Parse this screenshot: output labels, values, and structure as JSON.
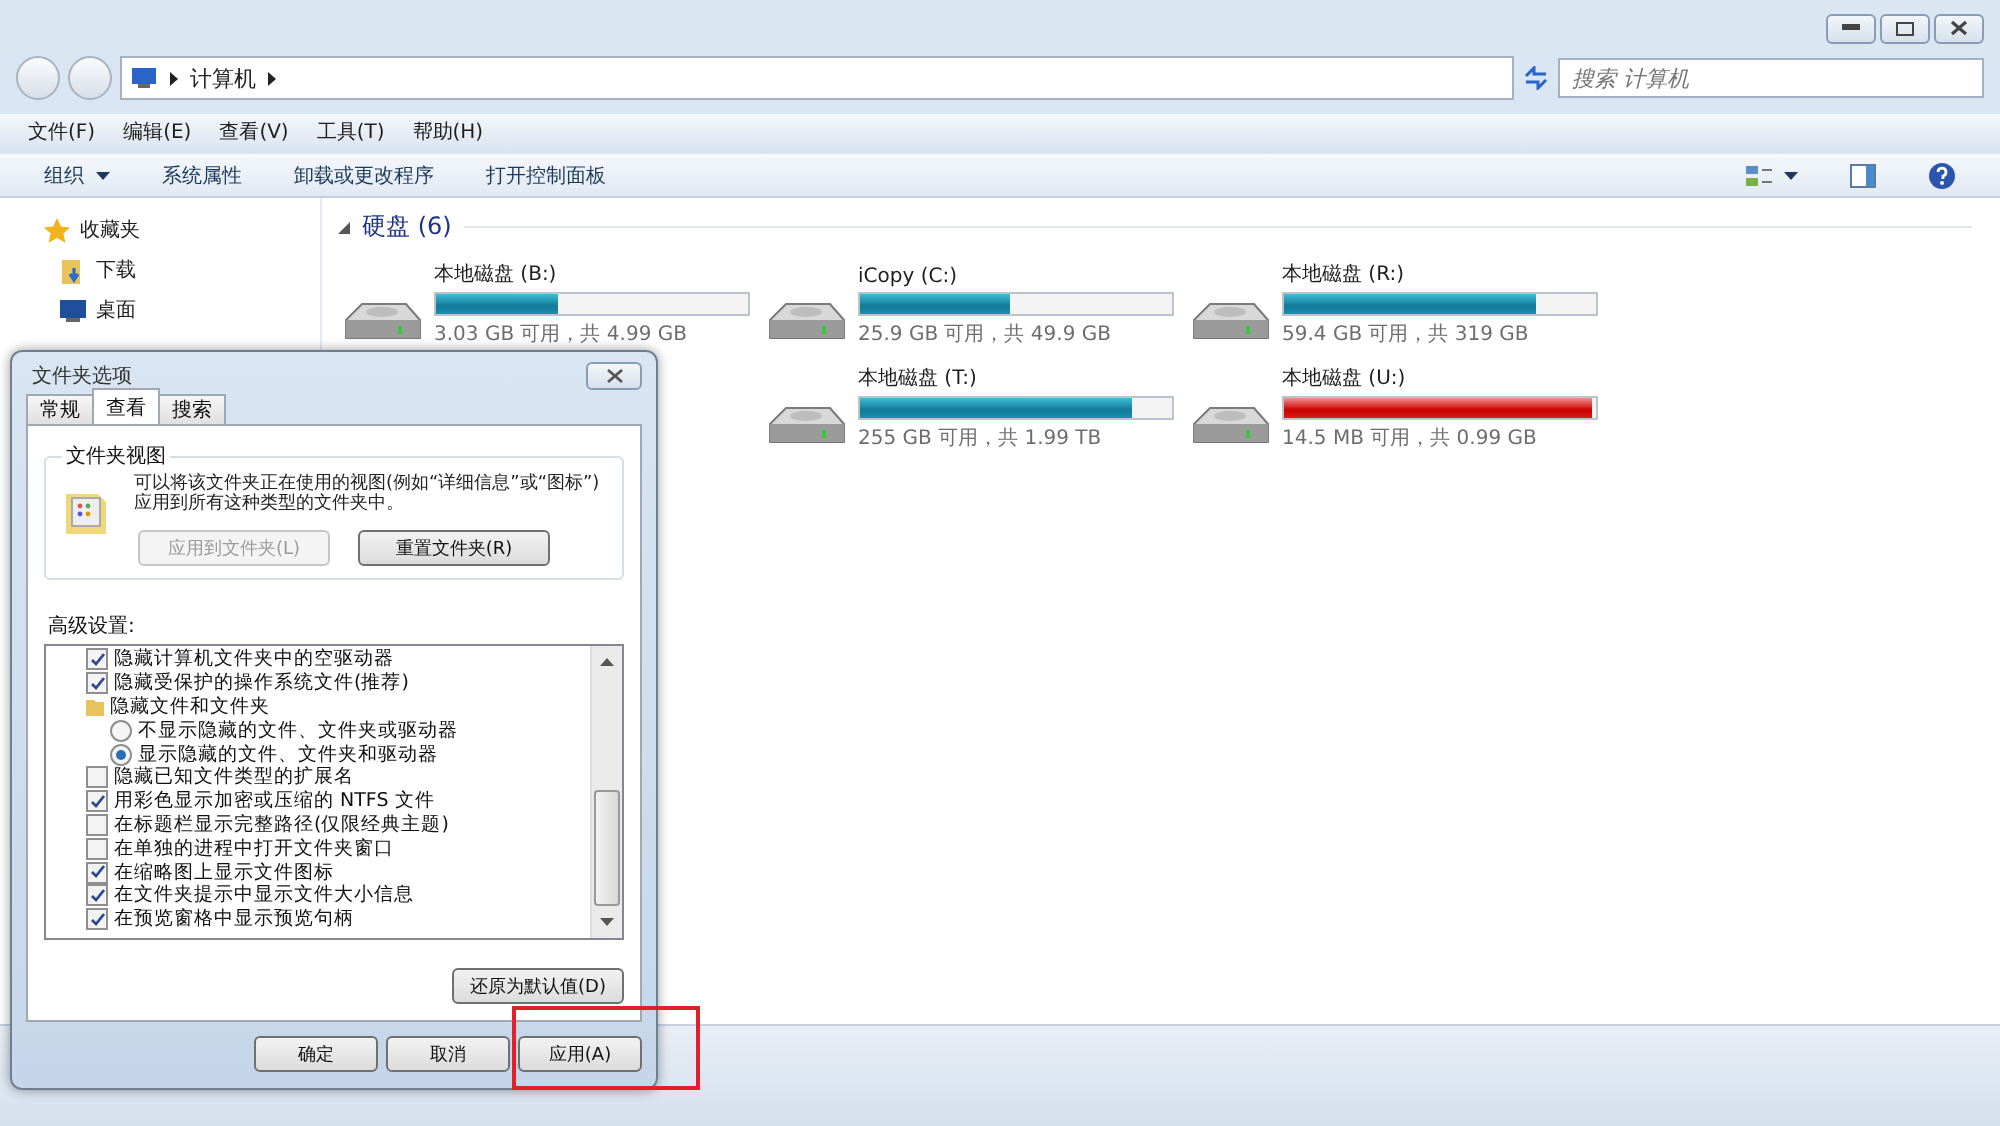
{
  "address": {
    "crumbs": [
      "计算机"
    ]
  },
  "search": {
    "placeholder": "搜索 计算机"
  },
  "menu": [
    "文件(F)",
    "编辑(E)",
    "查看(V)",
    "工具(T)",
    "帮助(H)"
  ],
  "commands": [
    {
      "label": "组织",
      "dropdown": true
    },
    {
      "label": "系统属性",
      "dropdown": false
    },
    {
      "label": "卸载或更改程序",
      "dropdown": false
    },
    {
      "label": "打开控制面板",
      "dropdown": false
    }
  ],
  "sidebar": {
    "items": [
      {
        "label": "收藏夹",
        "kind": "star"
      },
      {
        "label": "下载",
        "kind": "download"
      },
      {
        "label": "桌面",
        "kind": "desktop"
      }
    ]
  },
  "group": {
    "title": "硬盘 (6)"
  },
  "drives": [
    {
      "name": "本地磁盘 (B:)",
      "level": 0.39,
      "full": false,
      "info": "3.03 GB 可用，共 4.99 GB"
    },
    {
      "name": "iCopy (C:)",
      "level": 0.48,
      "full": false,
      "info": "25.9 GB 可用，共 49.9 GB"
    },
    {
      "name": "本地磁盘 (R:)",
      "level": 0.81,
      "full": false,
      "info": "59.4 GB 可用，共 319 GB"
    },
    {
      "name": "本地磁盘 (T:)",
      "level": 0.87,
      "full": false,
      "info": "255 GB 可用，共 1.99 TB"
    },
    {
      "name": "本地磁盘 (U:)",
      "level": 0.99,
      "full": true,
      "info": "14.5 MB 可用，共 0.99 GB"
    }
  ],
  "dialog": {
    "title": "文件夹选项",
    "tabs": [
      {
        "label": "常规",
        "selected": false
      },
      {
        "label": "查看",
        "selected": true
      },
      {
        "label": "搜索",
        "selected": false
      }
    ],
    "folder_views": {
      "title": "文件夹视图",
      "text": "可以将该文件夹正在使用的视图(例如“详细信息”或“图标”)应用到所有这种类型的文件夹中。",
      "buttons": [
        {
          "label": "应用到文件夹(L)",
          "disabled": true
        },
        {
          "label": "重置文件夹(R)",
          "disabled": false
        }
      ]
    },
    "advanced_label": "高级设置:",
    "settings": [
      {
        "kind": "checkbox",
        "label": "隐藏计算机文件夹中的空驱动器",
        "checked": true
      },
      {
        "kind": "checkbox",
        "label": "隐藏受保护的操作系统文件(推荐)",
        "checked": true
      },
      {
        "kind": "folder",
        "label": "隐藏文件和文件夹",
        "children": [
          {
            "kind": "radio",
            "label": "不显示隐藏的文件、文件夹或驱动器",
            "selected": false
          },
          {
            "kind": "radio",
            "label": "显示隐藏的文件、文件夹和驱动器",
            "selected": true
          }
        ]
      },
      {
        "kind": "checkbox",
        "label": "隐藏已知文件类型的扩展名",
        "checked": false
      },
      {
        "kind": "checkbox",
        "label": "用彩色显示加密或压缩的 NTFS 文件",
        "checked": true
      },
      {
        "kind": "checkbox",
        "label": "在标题栏显示完整路径(仅限经典主题)",
        "checked": false
      },
      {
        "kind": "checkbox",
        "label": "在单独的进程中打开文件夹窗口",
        "checked": false
      },
      {
        "kind": "checkbox",
        "label": "在缩略图上显示文件图标",
        "checked": true
      },
      {
        "kind": "checkbox",
        "label": "在文件夹提示中显示文件大小信息",
        "checked": true
      },
      {
        "kind": "checkbox",
        "label": "在预览窗格中显示预览句柄",
        "checked": true
      }
    ],
    "restore": "还原为默认值(D)",
    "buttons": [
      "确定",
      "取消",
      "应用(A)"
    ]
  }
}
